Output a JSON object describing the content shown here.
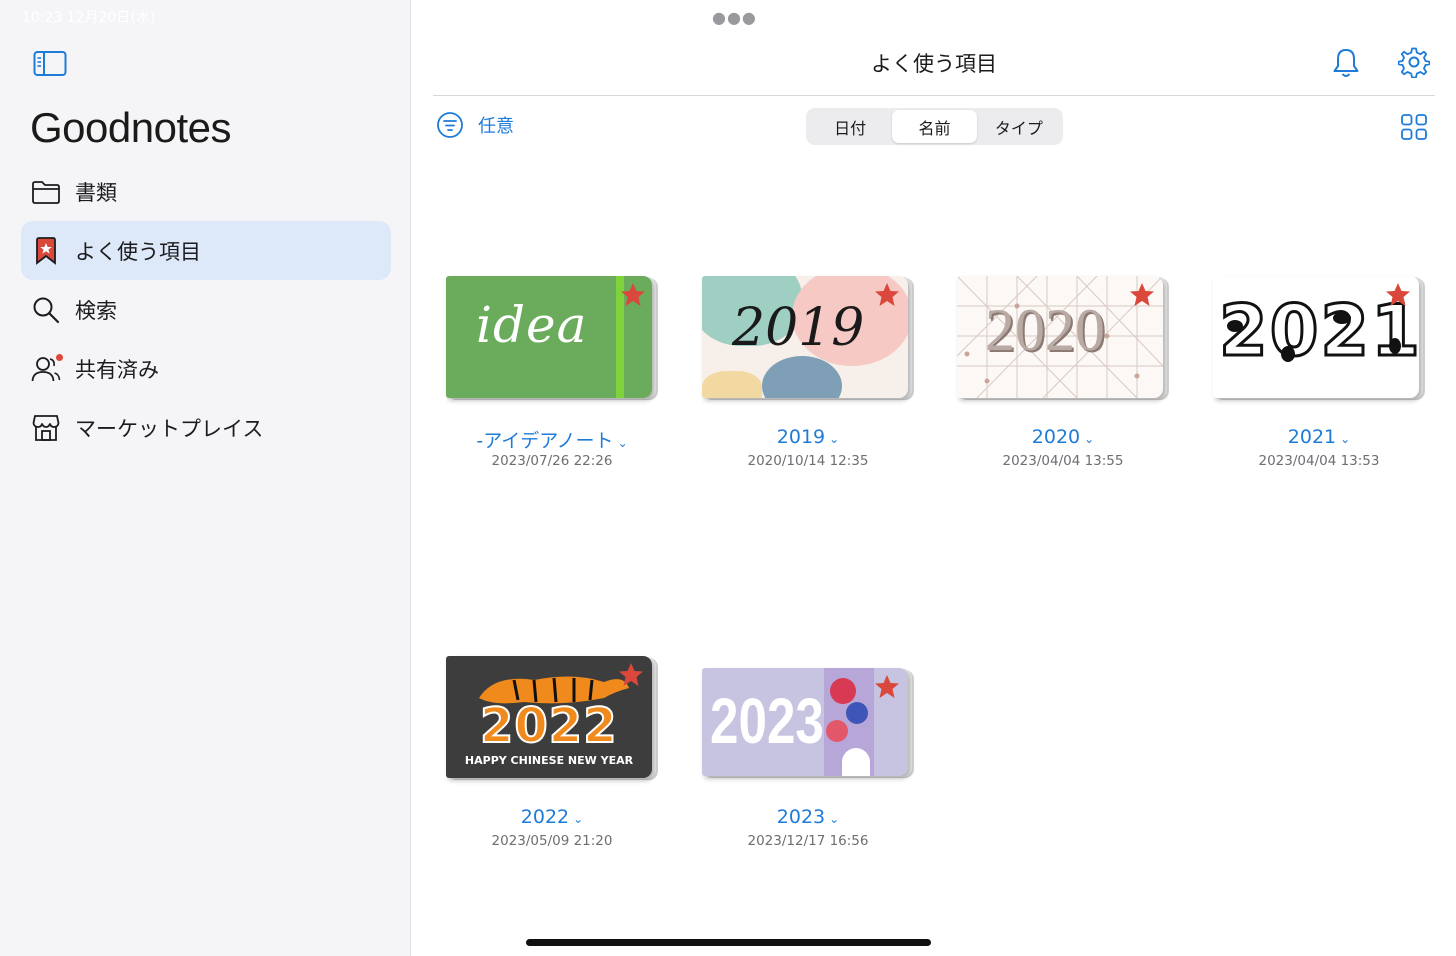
{
  "status_bar": {
    "time_date": "10:23  12月20日(水)"
  },
  "sidebar": {
    "app_title": "Goodnotes",
    "items": [
      {
        "label": "書類",
        "icon": "folder-icon"
      },
      {
        "label": "よく使う項目",
        "icon": "favorites-bookmark-icon",
        "active": true
      },
      {
        "label": "検索",
        "icon": "search-icon"
      },
      {
        "label": "共有済み",
        "icon": "shared-people-icon",
        "badge": "dot"
      },
      {
        "label": "マーケットプレイス",
        "icon": "marketplace-store-icon"
      }
    ]
  },
  "header": {
    "title": "よく使う項目",
    "filter_label": "任意",
    "sort_tabs": [
      "日付",
      "名前",
      "タイプ"
    ],
    "active_sort": "名前"
  },
  "notebooks": [
    {
      "name": "-アイデアノート",
      "date": "2023/07/26 22:26",
      "cover_text": "idea",
      "favorite": true
    },
    {
      "name": "2019",
      "date": "2020/10/14 12:35",
      "cover_text": "2019",
      "favorite": true
    },
    {
      "name": "2020",
      "date": "2023/04/04 13:55",
      "cover_text": "2020",
      "favorite": true
    },
    {
      "name": "2021",
      "date": "2023/04/04 13:53",
      "cover_text": "2021",
      "favorite": true
    },
    {
      "name": "2022",
      "date": "2023/05/09 21:20",
      "cover_text": "2022",
      "cover_subtitle": "HAPPY CHINESE NEW YEAR",
      "favorite": true
    },
    {
      "name": "2023",
      "date": "2023/12/17 16:56",
      "cover_text": "2023",
      "favorite": true
    }
  ],
  "colors": {
    "accent": "#1e7bd8",
    "active_nav": "#dde8f8",
    "star": "#d9483b"
  }
}
